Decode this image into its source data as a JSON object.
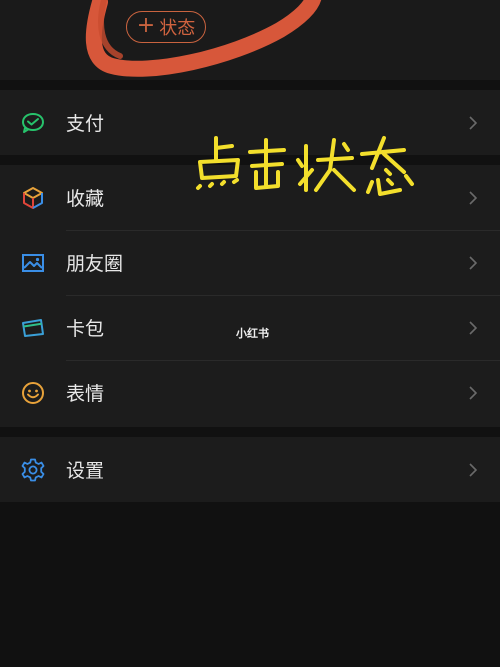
{
  "header": {
    "status_button_label": "状态",
    "status_button_icon": "plus-icon"
  },
  "annotation": {
    "handwritten_text": "点击状态",
    "handwritten_color": "#f3df2c",
    "scribble_color": "#d7573a"
  },
  "menu": {
    "group1": [
      {
        "label": "支付",
        "icon": "wechat-pay-icon",
        "color": "#27c26b"
      }
    ],
    "group2": [
      {
        "label": "收藏",
        "icon": "favorites-cube-icon"
      },
      {
        "label": "朋友圈",
        "icon": "moments-image-icon",
        "color": "#3a8ee6"
      },
      {
        "label": "卡包",
        "icon": "card-wallet-icon",
        "color": "#3aa0d8"
      },
      {
        "label": "表情",
        "icon": "emoji-icon",
        "color": "#e8a23a"
      }
    ],
    "group3": [
      {
        "label": "设置",
        "icon": "gear-icon",
        "color": "#3a8ee6"
      }
    ]
  },
  "watermark": "小红书"
}
